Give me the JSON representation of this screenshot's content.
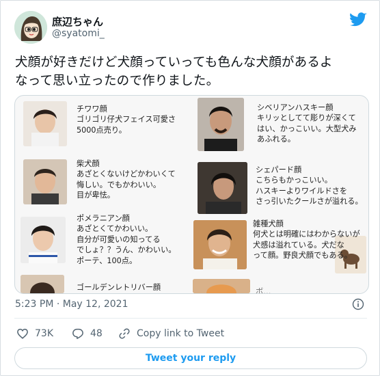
{
  "colors": {
    "accent": "#1d9bf0",
    "secondary_text": "#536471",
    "text": "#0f1419"
  },
  "header": {
    "display_name": "庶辺ちゃん",
    "handle": "@syatomi_",
    "avatar_icon": "user-avatar",
    "brand_icon": "twitter-bird-icon"
  },
  "tweet": {
    "line1": "犬顔が好きだけど犬顔っていっても色んな犬顔があるよ",
    "line2": "なって思い立ったので作りました。"
  },
  "media": {
    "captions": [
      "チワワ顔\nゴリゴリ仔犬フェイス可愛さ\n5000点売り。",
      "シベリアンハスキー顔\nキリッとしてて彫りが深くて\nはい、かっこいい。大型犬み\nあふれる。",
      "柴犬顔\nあざとくないけどかわいくて\n悔しい。でもかわいい。\n目が卑怯。",
      "シェパード顔\nこちらもかっこいい。\nハスキーよりワイルドさを\nさっ引いたクールさが溢れる。",
      "ポメラニアン顔\nあざとくてかわいい。\n自分が可愛いの知ってる\nでしょ？？うん、かわいい。\nポーテ、100点。",
      "雑種犬顔\n何犬とは明確にはわからないが\n犬感は溢れている。犬だな\nって顔。野良犬顔でもある。",
      "ゴールデンレトリバー顔",
      "ボ…"
    ]
  },
  "meta": {
    "timestamp": "5:23 PM · May 12, 2021",
    "info_icon": "info-icon"
  },
  "actions": {
    "like_count": "73K",
    "reply_count": "48",
    "copy_label": "Copy link to Tweet",
    "like_icon": "heart-icon",
    "reply_icon": "reply-bubble-icon",
    "copy_icon": "link-icon"
  },
  "reply_button": "Tweet your reply"
}
